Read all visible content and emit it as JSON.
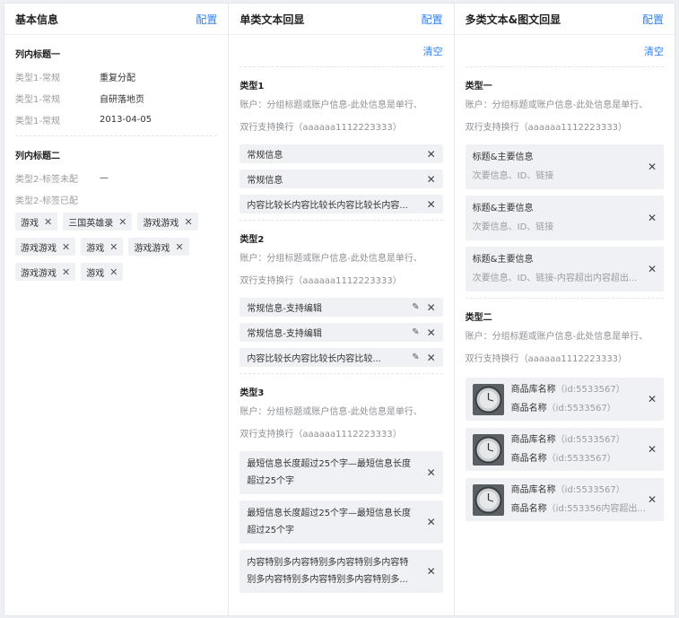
{
  "col1": {
    "title": "基本信息",
    "config": "配置",
    "section1": {
      "title": "列内标题一",
      "rows": [
        {
          "key": "类型1-常规",
          "value": "重复分配"
        },
        {
          "key": "类型1-常规",
          "value": "自研落地页"
        },
        {
          "key": "类型1-常规",
          "value": "2013-04-05"
        }
      ]
    },
    "section2": {
      "title": "列内标题二",
      "row1": {
        "key": "类型2-标签未配",
        "value": "—"
      },
      "row2_key": "类型2-标签已配",
      "tags": [
        "游戏",
        "三国英雄录",
        "游戏游戏",
        "游戏游戏",
        "游戏",
        "游戏游戏",
        "游戏游戏",
        "游戏"
      ]
    }
  },
  "col2": {
    "title": "单类文本回显",
    "config": "配置",
    "clear": "清空",
    "type1": {
      "title": "类型1",
      "desc1": "账户：分组标题或账户信息-此处信息是单行、",
      "desc2": "双行支持换行（aaaaaa1112223333）",
      "items": [
        "常规信息",
        "常规信息",
        "内容比较长内容比较长内容比较长内容..."
      ]
    },
    "type2": {
      "title": "类型2",
      "desc1": "账户：分组标题或账户信息-此处信息是单行、",
      "desc2": "双行支持换行（aaaaaa1112223333）",
      "items": [
        "常规信息-支持编辑",
        "常规信息-支持编辑",
        "内容比较长内容比较长内容比较..."
      ]
    },
    "type3": {
      "title": "类型3",
      "desc1": "账户：分组标题或账户信息-此处信息是单行、",
      "desc2": "双行支持换行（aaaaaa1112223333）",
      "items": [
        {
          "l1": "最短信息长度超过25个字—最短信息长度",
          "l2": "超过25个字"
        },
        {
          "l1": "最短信息长度超过25个字—最短信息长度",
          "l2": "超过25个字"
        },
        {
          "l1": "内容特别多内容特别多内容特别多内容特",
          "l2": "别多内容特别多内容特别多内容特别多..."
        }
      ]
    }
  },
  "col3": {
    "title": "多类文本&图文回显",
    "config": "配置",
    "clear": "清空",
    "type1": {
      "title": "类型一",
      "desc1": "账户：分组标题或账户信息-此处信息是单行、",
      "desc2": "双行支持换行（aaaaaa1112223333）",
      "cards": [
        {
          "main": "标题&主要信息",
          "sub": "次要信息、ID、链接"
        },
        {
          "main": "标题&主要信息",
          "sub": "次要信息、ID、链接"
        },
        {
          "main": "标题&主要信息",
          "sub": "次要信息、ID、链接-内容超出内容超出..."
        }
      ]
    },
    "type2": {
      "title": "类型二",
      "desc1": "账户：分组标题或账户信息-此处信息是单行、",
      "desc2": "双行支持换行（aaaaaa1112223333）",
      "products": [
        {
          "name": "商品库名称",
          "id1": "（id:5533567）",
          "name2": "商品名称",
          "id2": "（id:5533567）"
        },
        {
          "name": "商品库名称",
          "id1": "（id:5533567）",
          "name2": "商品名称",
          "id2": "（id:5533567）"
        },
        {
          "name": "商品库名称",
          "id1": "（id:5533567）",
          "name2": "商品名称",
          "id2": "（id:553356内容超出..."
        }
      ]
    }
  },
  "icons": {
    "close": "close-icon",
    "edit": "pencil-icon",
    "thumb": "watch-thumbnail"
  },
  "colors": {
    "accent": "#2f7ff0",
    "chip": "#f0f1f4",
    "muted": "#9a9ca1"
  }
}
